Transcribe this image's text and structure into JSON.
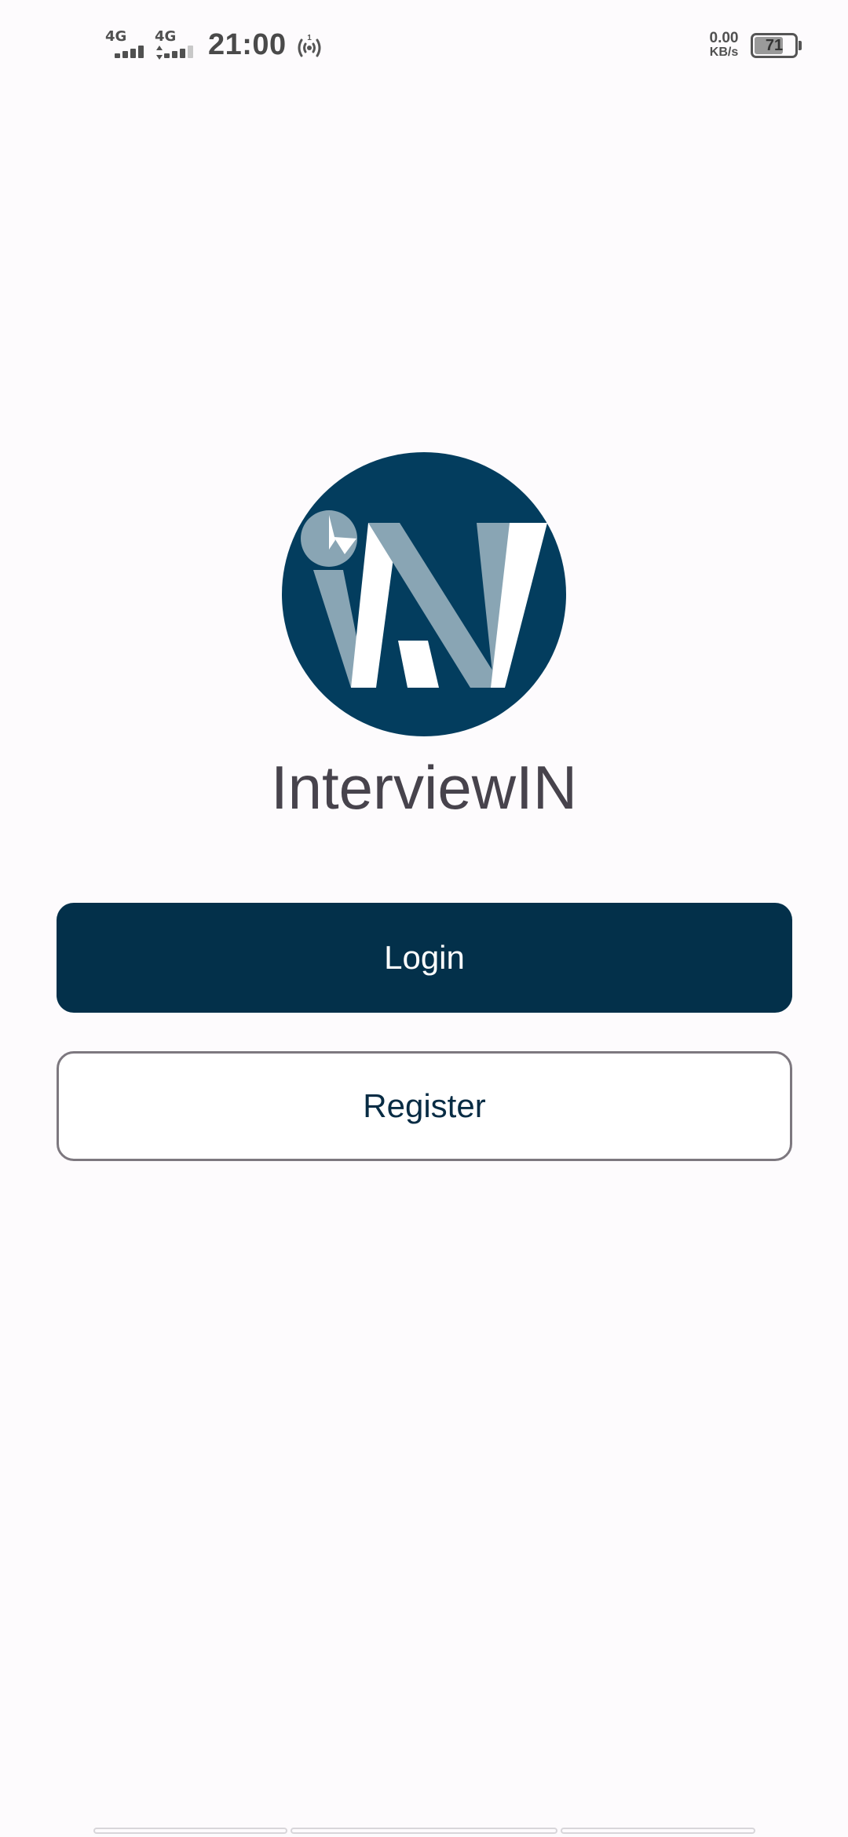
{
  "status_bar": {
    "sim1_network": "4G",
    "sim2_network": "4G",
    "time": "21:00",
    "hotspot_badge": "1",
    "net_speed_value": "0.00",
    "net_speed_unit": "KB/s",
    "battery_level": "71",
    "battery_fraction": 0.71
  },
  "app": {
    "name": "InterviewIN",
    "logo_icon": "interviewin-logo",
    "brand_color": "#033d5e",
    "accent_color": "#89a5b4"
  },
  "actions": {
    "login_label": "Login",
    "register_label": "Register"
  }
}
